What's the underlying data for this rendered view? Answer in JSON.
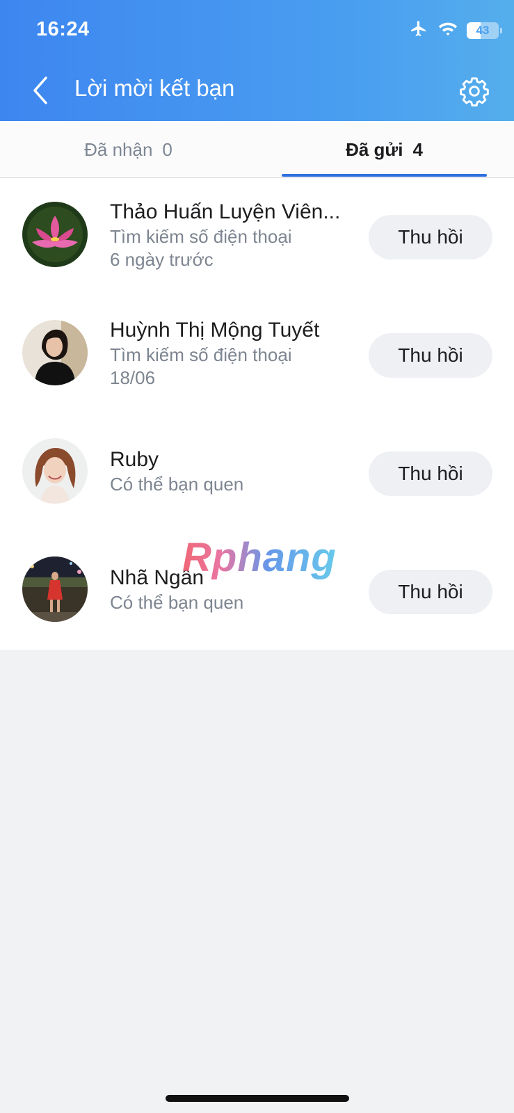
{
  "status_bar": {
    "time": "16:24",
    "battery_level": "43",
    "icons": [
      "airplane-icon",
      "wifi-icon",
      "battery-icon"
    ]
  },
  "header": {
    "title": "Lời mời kết bạn",
    "back_icon": "chevron-left-icon",
    "settings_icon": "gear-icon"
  },
  "tabs": [
    {
      "label": "Đã nhận",
      "count": "0",
      "selected": false
    },
    {
      "label": "Đã gửi",
      "count": "4",
      "selected": true
    }
  ],
  "requests": [
    {
      "name": "Thảo Huấn Luyện Viên...",
      "source": "Tìm kiếm số điện thoại",
      "time": "6 ngày trước",
      "action": "Thu hồi",
      "avatar": "lotus-avatar"
    },
    {
      "name": "Huỳnh Thị Mộng Tuyết",
      "source": "Tìm kiếm số điện thoại",
      "time": "18/06",
      "action": "Thu hồi",
      "avatar": "woman-avatar"
    },
    {
      "name": "Ruby",
      "source": "Có thể bạn quen",
      "action": "Thu hồi",
      "avatar": "smiling-woman-avatar"
    },
    {
      "name": "Nhã Ngân",
      "source": "Có thể bạn quen",
      "action": "Thu hồi",
      "avatar": "night-photo-avatar"
    }
  ],
  "watermark": "Rphang",
  "colors": {
    "header_start": "#3d86f0",
    "header_end": "#55aeec",
    "tab_indicator": "#2f6fe0",
    "button_bg": "#eef0f4",
    "page_bg": "#f1f2f4"
  }
}
